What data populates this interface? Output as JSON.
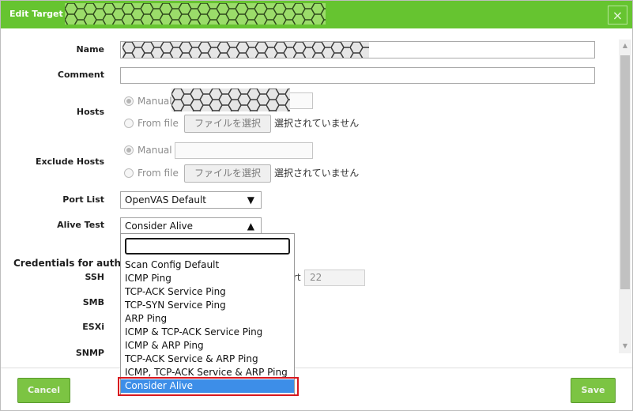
{
  "dialog": {
    "title": "Edit Target"
  },
  "icons": {
    "close": "×",
    "select_closed": "▼",
    "select_open": "▲",
    "scroll_up": "▲",
    "scroll_down": "▼"
  },
  "form": {
    "name": {
      "label": "Name"
    },
    "comment": {
      "label": "Comment"
    },
    "hosts": {
      "label": "Hosts",
      "manual": "Manual",
      "from_file": "From file",
      "file_button": "ファイルを選択",
      "file_status": "選択されていません"
    },
    "exclude_hosts": {
      "label": "Exclude Hosts",
      "manual": "Manual",
      "from_file": "From file",
      "file_button": "ファイルを選択",
      "file_status": "選択されていません"
    },
    "port_list": {
      "label": "Port List",
      "value": "OpenVAS Default"
    },
    "alive_test": {
      "label": "Alive Test",
      "value": "Consider Alive",
      "options": [
        "Scan Config Default",
        "ICMP Ping",
        "TCP-ACK Service Ping",
        "TCP-SYN Service Ping",
        "ARP Ping",
        "ICMP & TCP-ACK Service Ping",
        "ICMP & ARP Ping",
        "TCP-ACK Service & ARP Ping",
        "ICMP, TCP-ACK Service & ARP Ping",
        "Consider Alive"
      ],
      "selected_index": 9
    },
    "credentials": {
      "heading": "Credentials for authe",
      "ssh": "SSH",
      "smb": "SMB",
      "esxi": "ESXi",
      "snmp": "SNMP",
      "port_label": "rt",
      "port_value": "22"
    }
  },
  "footer": {
    "cancel": "Cancel",
    "save": "Save"
  },
  "colors": {
    "title_bar": "#66c430",
    "button": "#7cc443",
    "button_border": "#5a9b2d",
    "selected_option": "#3d8ee8",
    "highlight_box": "#d7181f"
  }
}
